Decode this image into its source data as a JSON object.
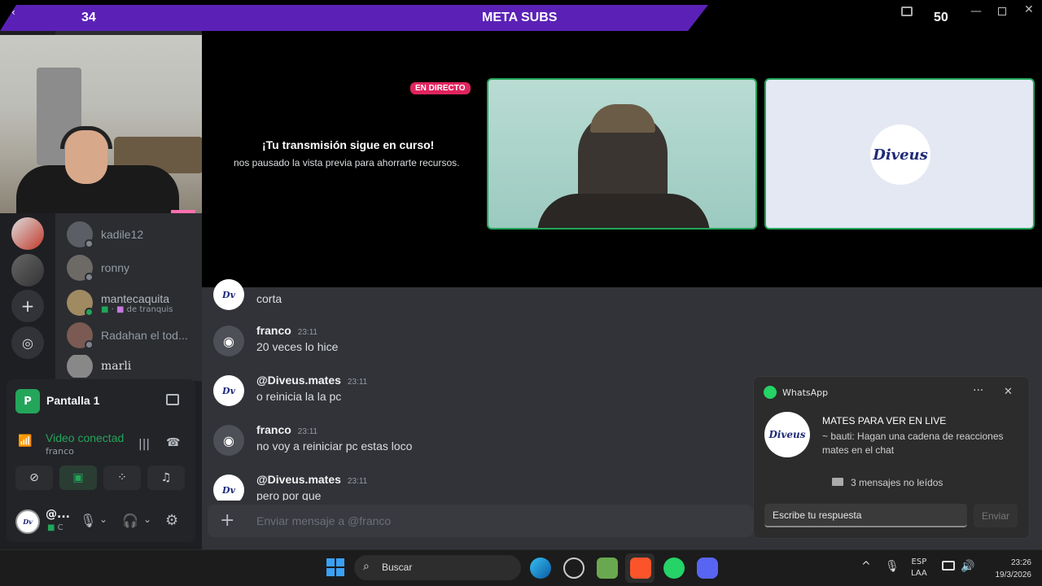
{
  "meta_bar": {
    "left_count": "34",
    "title": "META SUBS",
    "right_count": "50"
  },
  "stage": {
    "live_badge": "EN DIRECTO",
    "headline": "¡Tu transmisión sigue en curso!",
    "subtext": "nos pausado la vista previa para ahorrarte recursos.",
    "tile_logo": "Diveus"
  },
  "members": [
    {
      "name": "kadile12",
      "status": ""
    },
    {
      "name": "ronny",
      "status": ""
    },
    {
      "name": "mantecaquita",
      "status": "de tranquis"
    },
    {
      "name": "Radahan el tod...",
      "status": ""
    },
    {
      "name": "marli",
      "status": ""
    }
  ],
  "voice": {
    "screen_label": "Pantalla 1",
    "screen_badge": "P",
    "status": "Video conectad",
    "channel": "franco",
    "user_short": "@...",
    "user_sub": "C"
  },
  "chat": {
    "messages": [
      {
        "author": "",
        "time": "",
        "text": "corta",
        "avatar": "diveus"
      },
      {
        "author": "franco",
        "time": "23:11",
        "text": "20 veces lo hice",
        "avatar": "discord"
      },
      {
        "author": "@Diveus.mates",
        "time": "23:11",
        "text": "o reinicia la la pc",
        "avatar": "diveus"
      },
      {
        "author": "franco",
        "time": "23:11",
        "text": "no voy a reiniciar pc estas loco",
        "avatar": "discord"
      },
      {
        "author": "@Diveus.mates",
        "time": "23:11",
        "text": "pero por que",
        "avatar": "diveus"
      }
    ],
    "input_placeholder": "Enviar mensaje a @franco"
  },
  "whatsapp": {
    "app_name": "WhatsApp",
    "title": "MATES PARA VER EN LIVE",
    "body": "~ bauti: Hagan una cadena de reacciones mates en el chat",
    "unread": "3 mensajes no leídos",
    "reply_placeholder": "Escribe tu respuesta",
    "send_label": "Enviar",
    "avatar_text": "Diveus"
  },
  "taskbar": {
    "search_label": "Buscar",
    "lang_top": "ESP",
    "lang_bottom": "LAA",
    "time": "23:26",
    "date": "19/3/2026"
  },
  "colors": {
    "accent_purple": "#5b21b6",
    "live_red": "#e0245e",
    "discord_green": "#23a55a",
    "whatsapp_green": "#25d366"
  }
}
